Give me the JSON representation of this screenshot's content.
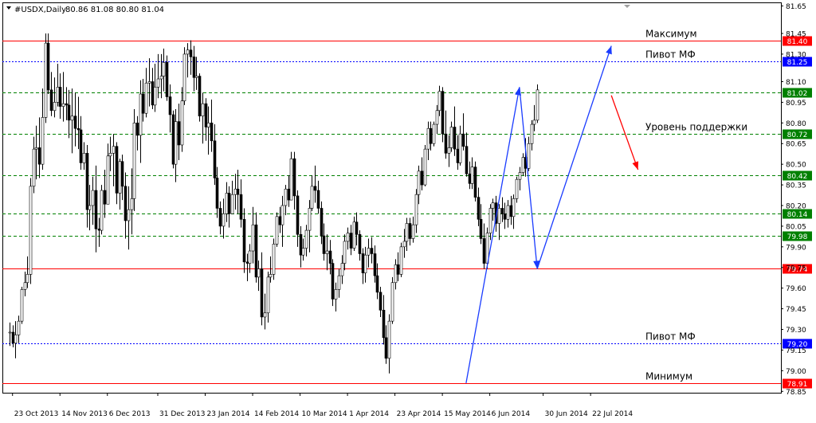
{
  "header": {
    "symbol": "#USDX,Daily",
    "ohlc": "80.86 81.08 80.80 81.04"
  },
  "chart_data": {
    "type": "candlestick",
    "symbol": "#USDX",
    "timeframe": "Daily",
    "ylim": [
      78.84,
      81.67
    ],
    "y_ticks": [
      "81.65",
      "81.45",
      "81.30",
      "81.10",
      "80.95",
      "80.80",
      "80.65",
      "80.50",
      "80.35",
      "80.20",
      "80.05",
      "79.90",
      "79.75",
      "79.60",
      "79.45",
      "79.30",
      "79.15",
      "79.00",
      "78.85"
    ],
    "x_ticks": [
      "23 Oct 2013",
      "14 Nov 2013",
      "6 Dec 2013",
      "31 Dec 2013",
      "23 Jan 2014",
      "14 Feb 2014",
      "10 Mar 2014",
      "1 Apr 2014",
      "23 Apr 2014",
      "15 May 2014",
      "6 Jun 2014",
      "30 Jun 2014",
      "22 Jul 2014"
    ],
    "x_tick_bars": [
      1,
      17,
      33,
      50,
      66,
      82,
      98,
      114,
      130,
      146,
      162,
      180,
      196
    ],
    "level_lines": [
      {
        "value": 81.4,
        "label": "81.40",
        "style": "solid",
        "color": "#ff0000",
        "annotation": "Максимум"
      },
      {
        "value": 81.25,
        "label": "81.25",
        "style": "dotted",
        "color": "#0000ff",
        "annotation": "Пивот МФ"
      },
      {
        "value": 81.02,
        "label": "81.02",
        "style": "dashed",
        "color": "#008000",
        "annotation": ""
      },
      {
        "value": 80.72,
        "label": "80.72",
        "style": "dashed",
        "color": "#008000",
        "annotation": "Уровень поддержки"
      },
      {
        "value": 80.42,
        "label": "80.42",
        "style": "dashed",
        "color": "#008000",
        "annotation": ""
      },
      {
        "value": 80.14,
        "label": "80.14",
        "style": "dashed",
        "color": "#008000",
        "annotation": ""
      },
      {
        "value": 79.98,
        "label": "79.98",
        "style": "dashed",
        "color": "#008000",
        "annotation": ""
      },
      {
        "value": 79.74,
        "label": "79.74",
        "style": "solid",
        "color": "#ff0000",
        "annotation": ""
      },
      {
        "value": 79.2,
        "label": "79.20",
        "style": "dotted",
        "color": "#0000ff",
        "annotation": "Пивот МФ"
      },
      {
        "value": 78.91,
        "label": "78.91",
        "style": "solid",
        "color": "#ff0000",
        "annotation": "Минимум"
      }
    ],
    "arrows": [
      {
        "from": [
          154,
          78.91
        ],
        "to": [
          172,
          81.06
        ],
        "color": "#1a3cff"
      },
      {
        "from": [
          172,
          81.06
        ],
        "to": [
          178,
          79.74
        ],
        "color": "#1a3cff"
      },
      {
        "from": [
          178,
          79.74
        ],
        "to": [
          203,
          81.36
        ],
        "color": "#1a3cff"
      },
      {
        "from": [
          203,
          81.0
        ],
        "to": [
          212,
          80.46
        ],
        "color": "#ff0000"
      }
    ],
    "candles_ohlc": [
      [
        79.28,
        79.35,
        79.18,
        79.28
      ],
      [
        79.28,
        79.33,
        79.17,
        79.2
      ],
      [
        79.2,
        79.36,
        79.09,
        79.26
      ],
      [
        79.26,
        79.4,
        79.2,
        79.36
      ],
      [
        79.36,
        79.61,
        79.34,
        79.59
      ],
      [
        79.59,
        79.72,
        79.54,
        79.64
      ],
      [
        79.64,
        79.83,
        79.6,
        79.7
      ],
      [
        79.7,
        80.4,
        79.63,
        80.34
      ],
      [
        80.34,
        80.7,
        80.29,
        80.61
      ],
      [
        80.61,
        80.78,
        80.39,
        80.62
      ],
      [
        80.62,
        80.84,
        80.4,
        80.5
      ],
      [
        80.5,
        81.05,
        80.46,
        80.84
      ],
      [
        80.84,
        81.45,
        80.8,
        81.38
      ],
      [
        81.38,
        81.45,
        81.01,
        81.04
      ],
      [
        81.04,
        81.17,
        80.85,
        80.89
      ],
      [
        80.89,
        81.13,
        80.84,
        80.95
      ],
      [
        80.95,
        81.23,
        80.92,
        81.06
      ],
      [
        81.06,
        81.16,
        80.83,
        80.92
      ],
      [
        80.92,
        81.17,
        80.81,
        80.94
      ],
      [
        80.94,
        81.06,
        80.82,
        80.93
      ],
      [
        80.93,
        81.04,
        80.69,
        80.82
      ],
      [
        80.82,
        81.05,
        80.58,
        80.85
      ],
      [
        80.85,
        81.02,
        80.63,
        80.76
      ],
      [
        80.76,
        80.99,
        80.61,
        80.75
      ],
      [
        80.75,
        80.85,
        80.46,
        80.51
      ],
      [
        80.51,
        80.66,
        80.46,
        80.58
      ],
      [
        80.58,
        80.64,
        80.04,
        80.17
      ],
      [
        80.17,
        80.35,
        80.02,
        80.2
      ],
      [
        80.2,
        80.41,
        80.06,
        80.31
      ],
      [
        80.31,
        80.49,
        79.86,
        80.03
      ],
      [
        80.03,
        80.11,
        79.9,
        80.02
      ],
      [
        80.02,
        80.35,
        79.99,
        80.31
      ],
      [
        80.31,
        80.46,
        80.11,
        80.21
      ],
      [
        80.21,
        80.65,
        80.21,
        80.56
      ],
      [
        80.56,
        80.7,
        80.45,
        80.58
      ],
      [
        80.58,
        80.72,
        80.34,
        80.63
      ],
      [
        80.63,
        80.66,
        80.21,
        80.29
      ],
      [
        80.29,
        80.54,
        80.17,
        80.52
      ],
      [
        80.52,
        80.57,
        80.24,
        80.34
      ],
      [
        80.34,
        80.44,
        79.96,
        80.09
      ],
      [
        80.09,
        80.34,
        79.88,
        80.17
      ],
      [
        80.17,
        80.47,
        79.99,
        80.25
      ],
      [
        80.25,
        80.9,
        80.16,
        80.8
      ],
      [
        80.8,
        80.85,
        80.6,
        80.71
      ],
      [
        80.71,
        81.11,
        80.51,
        81.01
      ],
      [
        81.01,
        81.12,
        80.81,
        80.87
      ],
      [
        80.87,
        81.2,
        80.84,
        81.09
      ],
      [
        81.09,
        81.27,
        80.92,
        81.1
      ],
      [
        81.1,
        81.2,
        80.9,
        80.93
      ],
      [
        80.93,
        81.23,
        80.88,
        81.06
      ],
      [
        81.06,
        81.3,
        80.98,
        81.12
      ],
      [
        81.12,
        81.3,
        80.98,
        81.14
      ],
      [
        81.14,
        81.34,
        81.03,
        81.24
      ],
      [
        81.24,
        81.29,
        80.96,
        80.99
      ],
      [
        80.99,
        81.08,
        80.73,
        80.86
      ],
      [
        80.86,
        80.89,
        80.47,
        80.5
      ],
      [
        80.5,
        80.9,
        80.37,
        80.81
      ],
      [
        80.81,
        80.94,
        80.53,
        80.64
      ],
      [
        80.64,
        81.06,
        80.59,
        80.96
      ],
      [
        80.96,
        81.35,
        80.93,
        81.3
      ],
      [
        81.3,
        81.38,
        81.13,
        81.33
      ],
      [
        81.33,
        81.4,
        81.15,
        81.28
      ],
      [
        81.28,
        81.36,
        81.03,
        81.13
      ],
      [
        81.13,
        81.28,
        81.04,
        81.14
      ],
      [
        81.14,
        81.16,
        80.81,
        80.85
      ],
      [
        80.85,
        81.02,
        80.65,
        80.94
      ],
      [
        80.94,
        80.98,
        80.67,
        80.77
      ],
      [
        80.77,
        80.92,
        80.57,
        80.8
      ],
      [
        80.8,
        80.97,
        80.59,
        80.67
      ],
      [
        80.67,
        80.79,
        80.35,
        80.4
      ],
      [
        80.4,
        80.48,
        80.11,
        80.18
      ],
      [
        80.18,
        80.23,
        79.99,
        80.05
      ],
      [
        80.05,
        80.25,
        79.96,
        80.14
      ],
      [
        80.14,
        80.37,
        80.08,
        80.29
      ],
      [
        80.29,
        80.34,
        80.04,
        80.14
      ],
      [
        80.14,
        80.38,
        80.14,
        80.28
      ],
      [
        80.28,
        80.43,
        80.17,
        80.32
      ],
      [
        80.32,
        80.46,
        80.14,
        80.28
      ],
      [
        80.28,
        80.39,
        80.04,
        80.1
      ],
      [
        80.1,
        80.18,
        79.71,
        79.79
      ],
      [
        79.79,
        79.85,
        79.65,
        79.78
      ],
      [
        79.78,
        79.92,
        79.71,
        79.87
      ],
      [
        79.87,
        80.19,
        79.78,
        80.06
      ],
      [
        80.06,
        80.15,
        79.64,
        79.68
      ],
      [
        79.68,
        79.8,
        79.58,
        79.74
      ],
      [
        79.74,
        79.86,
        79.33,
        79.39
      ],
      [
        79.39,
        79.56,
        79.3,
        79.42
      ],
      [
        79.42,
        79.72,
        79.35,
        79.68
      ],
      [
        79.68,
        79.83,
        79.64,
        79.7
      ],
      [
        79.7,
        79.96,
        79.66,
        79.92
      ],
      [
        79.92,
        80.15,
        79.9,
        80.12
      ],
      [
        80.12,
        80.19,
        80.0,
        80.06
      ],
      [
        80.06,
        80.27,
        79.9,
        80.2
      ],
      [
        80.2,
        80.35,
        80.13,
        80.32
      ],
      [
        80.32,
        80.42,
        80.19,
        80.24
      ],
      [
        80.24,
        80.59,
        80.24,
        80.54
      ],
      [
        80.54,
        80.59,
        80.17,
        80.27
      ],
      [
        80.27,
        80.31,
        79.9,
        79.99
      ],
      [
        79.99,
        80.05,
        79.75,
        79.84
      ],
      [
        79.84,
        79.96,
        79.8,
        79.89
      ],
      [
        79.89,
        80.06,
        79.83,
        80.02
      ],
      [
        80.02,
        80.24,
        79.86,
        80.18
      ],
      [
        80.18,
        80.42,
        80.16,
        80.34
      ],
      [
        80.34,
        80.49,
        80.22,
        80.31
      ],
      [
        80.31,
        80.38,
        80.14,
        80.18
      ],
      [
        80.18,
        80.23,
        79.92,
        79.98
      ],
      [
        79.98,
        80.07,
        79.8,
        79.85
      ],
      [
        79.85,
        79.99,
        79.73,
        79.87
      ],
      [
        79.87,
        79.95,
        79.7,
        79.78
      ],
      [
        79.78,
        79.81,
        79.47,
        79.52
      ],
      [
        79.52,
        79.64,
        79.43,
        79.59
      ],
      [
        79.59,
        79.74,
        79.53,
        79.69
      ],
      [
        79.69,
        79.84,
        79.63,
        79.78
      ],
      [
        79.78,
        79.99,
        79.73,
        79.94
      ],
      [
        79.94,
        80.04,
        79.88,
        80.0
      ],
      [
        80.0,
        80.06,
        79.84,
        79.89
      ],
      [
        79.89,
        80.12,
        79.87,
        80.08
      ],
      [
        80.08,
        80.15,
        79.91,
        79.99
      ],
      [
        79.99,
        80.02,
        79.8,
        79.85
      ],
      [
        79.85,
        79.89,
        79.63,
        79.71
      ],
      [
        79.71,
        79.9,
        79.64,
        79.84
      ],
      [
        79.84,
        79.96,
        79.75,
        79.89
      ],
      [
        79.89,
        79.97,
        79.78,
        79.85
      ],
      [
        79.85,
        79.91,
        79.64,
        79.69
      ],
      [
        79.69,
        79.78,
        79.52,
        79.57
      ],
      [
        79.57,
        79.61,
        79.39,
        79.44
      ],
      [
        79.44,
        79.55,
        79.19,
        79.24
      ],
      [
        79.24,
        79.33,
        79.05,
        79.09
      ],
      [
        79.09,
        79.41,
        78.98,
        79.36
      ],
      [
        79.36,
        79.68,
        79.34,
        79.64
      ],
      [
        79.64,
        79.81,
        79.59,
        79.77
      ],
      [
        79.77,
        79.86,
        79.65,
        79.7
      ],
      [
        79.7,
        79.93,
        79.68,
        79.9
      ],
      [
        79.9,
        80.03,
        79.82,
        79.94
      ],
      [
        79.94,
        80.11,
        79.87,
        80.07
      ],
      [
        80.07,
        80.11,
        79.91,
        79.96
      ],
      [
        79.96,
        80.12,
        79.93,
        80.06
      ],
      [
        80.06,
        80.32,
        80.0,
        80.28
      ],
      [
        80.28,
        80.49,
        80.21,
        80.45
      ],
      [
        80.45,
        80.55,
        80.31,
        80.35
      ],
      [
        80.35,
        80.64,
        80.34,
        80.61
      ],
      [
        80.61,
        80.81,
        80.53,
        80.76
      ],
      [
        80.76,
        80.81,
        80.6,
        80.65
      ],
      [
        80.65,
        80.81,
        80.63,
        80.79
      ],
      [
        80.79,
        80.93,
        80.72,
        80.89
      ],
      [
        80.89,
        81.07,
        80.85,
        81.03
      ],
      [
        81.03,
        81.06,
        80.66,
        80.72
      ],
      [
        80.72,
        80.89,
        80.54,
        80.58
      ],
      [
        80.58,
        80.71,
        80.48,
        80.62
      ],
      [
        80.62,
        80.81,
        80.59,
        80.77
      ],
      [
        80.77,
        80.92,
        80.56,
        80.61
      ],
      [
        80.61,
        80.71,
        80.46,
        80.51
      ],
      [
        80.51,
        80.78,
        80.49,
        80.72
      ],
      [
        80.72,
        80.87,
        80.6,
        80.63
      ],
      [
        80.63,
        80.73,
        80.41,
        80.43
      ],
      [
        80.43,
        80.52,
        80.32,
        80.36
      ],
      [
        80.36,
        80.55,
        80.32,
        80.48
      ],
      [
        80.48,
        80.52,
        80.23,
        80.26
      ],
      [
        80.26,
        80.33,
        80.05,
        80.1
      ],
      [
        80.1,
        80.21,
        79.92,
        79.96
      ],
      [
        79.96,
        80.07,
        79.74,
        79.78
      ],
      [
        79.78,
        80.04,
        79.74,
        80.0
      ],
      [
        80.0,
        80.21,
        79.95,
        80.18
      ],
      [
        80.18,
        80.25,
        80.09,
        80.22
      ],
      [
        80.22,
        80.27,
        80.01,
        80.07
      ],
      [
        80.07,
        80.21,
        79.95,
        80.18
      ],
      [
        80.18,
        80.26,
        80.08,
        80.14
      ],
      [
        80.14,
        80.22,
        80.03,
        80.1
      ],
      [
        80.1,
        80.24,
        80.04,
        80.2
      ],
      [
        80.2,
        80.27,
        80.06,
        80.12
      ],
      [
        80.12,
        80.28,
        80.03,
        80.25
      ],
      [
        80.25,
        80.41,
        80.22,
        80.39
      ],
      [
        80.39,
        80.48,
        80.31,
        80.44
      ],
      [
        80.44,
        80.58,
        80.42,
        80.55
      ],
      [
        80.55,
        80.69,
        80.41,
        80.47
      ],
      [
        80.47,
        80.7,
        80.45,
        80.65
      ],
      [
        80.65,
        80.82,
        80.6,
        80.79
      ],
      [
        80.79,
        80.93,
        80.74,
        80.82
      ],
      [
        80.82,
        81.08,
        80.8,
        81.04
      ]
    ]
  }
}
